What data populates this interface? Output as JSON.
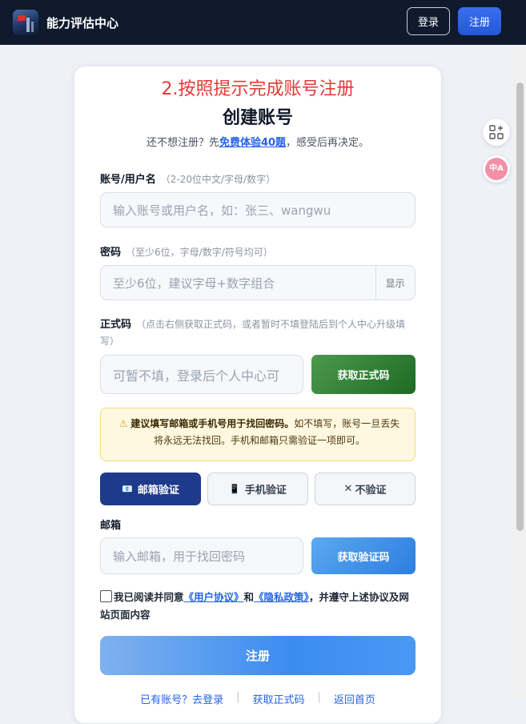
{
  "header": {
    "brand": "能力评估中心",
    "login_label": "登录",
    "register_label": "注册"
  },
  "side": {
    "translate_label": "中A"
  },
  "card": {
    "hint": "2.按照提示完成账号注册",
    "title": "创建账号",
    "subtitle_pre": "还不想注册？先",
    "subtitle_link": "免费体验40题",
    "subtitle_post": "，感受后再决定。",
    "account": {
      "label": "账号/用户名",
      "note": "（2-20位中文/字母/数字）",
      "placeholder": "输入账号或用户名，如：张三、wangwu"
    },
    "password": {
      "label": "密码",
      "note": "（至少6位，字母/数字/符号均可）",
      "placeholder": "至少6位，建议字母+数字组合",
      "show_label": "显示"
    },
    "code": {
      "label": "正式码",
      "note": "（点击右侧获取正式码，或者暂时不填登陆后到个人中心升级填写）",
      "placeholder": "可暂不填，登录后个人中心可",
      "get_label": "获取正式码"
    },
    "warning": {
      "bold": "建议填写邮箱或手机号用于找回密码。",
      "text": "如不填写，账号一旦丢失将永远无法找回。手机和邮箱只需验证一项即可。"
    },
    "tabs": [
      {
        "label": "邮箱验证",
        "icon": "email-icon"
      },
      {
        "label": "手机验证",
        "icon": "phone-icon"
      },
      {
        "label": "不验证",
        "icon": "close-icon"
      }
    ],
    "email": {
      "label": "邮箱",
      "placeholder": "输入邮箱，用于找回密码",
      "get_label": "获取验证码"
    },
    "agree": {
      "pre": "我已阅读并同意",
      "user_link": "《用户协议》",
      "and": "和",
      "privacy_link": "《隐私政策》",
      "post": "，并遵守上述协议及网站页面内容"
    },
    "submit_label": "注册",
    "links": [
      "已有账号？去登录",
      "获取正式码",
      "返回首页"
    ]
  },
  "colors": {
    "topbar": "#0f1a2e",
    "accent": "#2563eb",
    "hint": "#e53935",
    "active_tab": "#1e3a8a"
  }
}
